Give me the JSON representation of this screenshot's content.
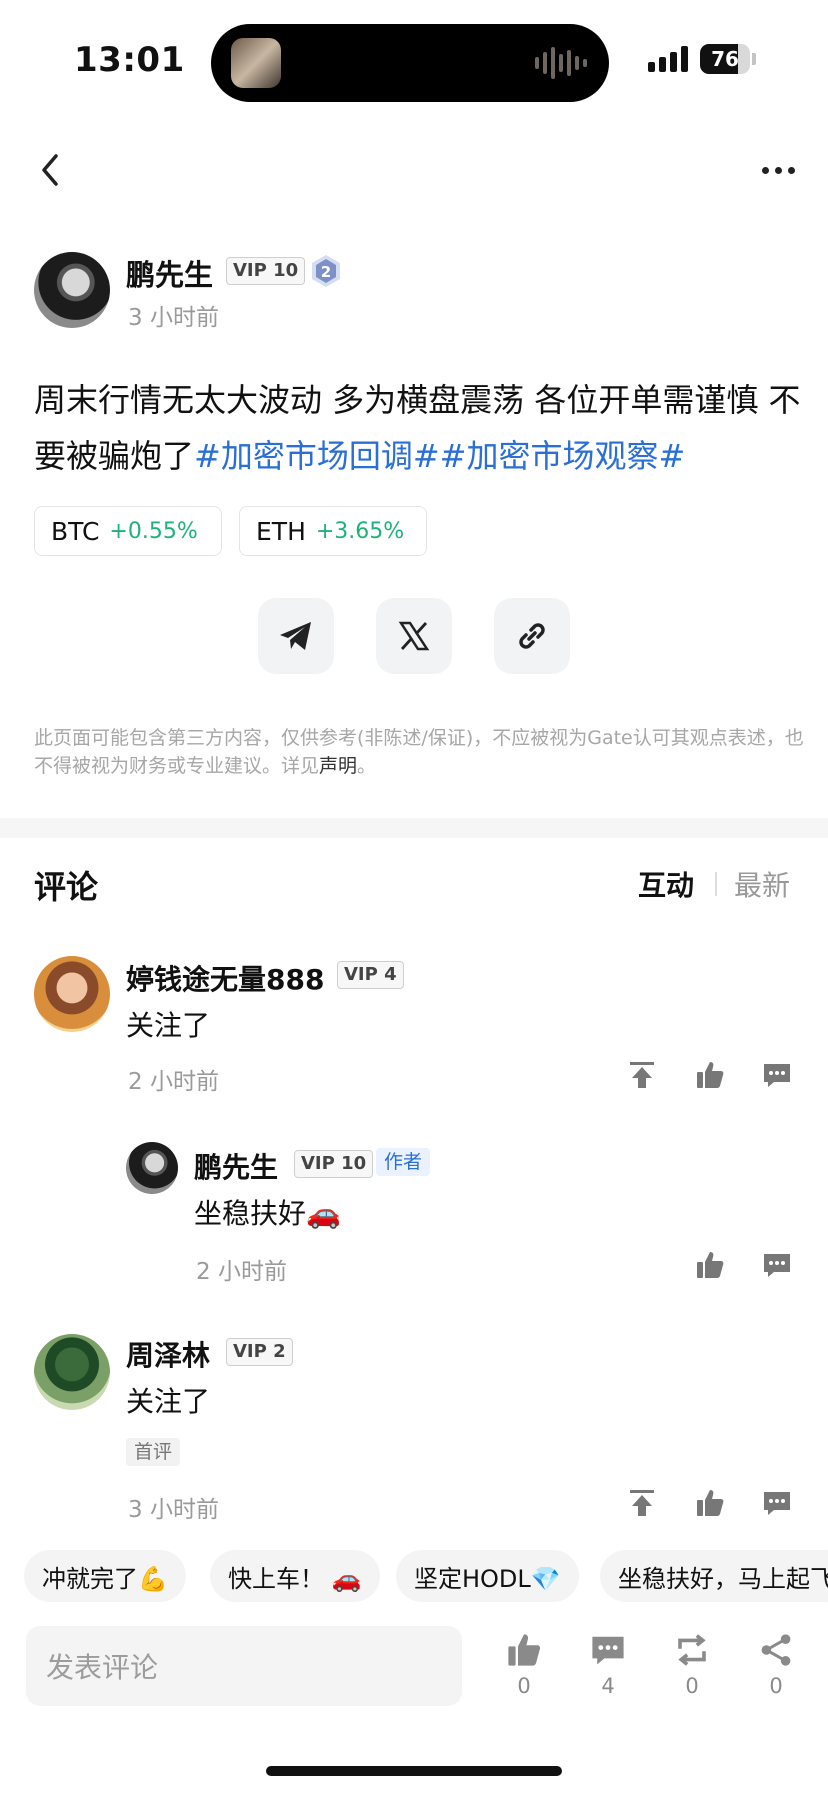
{
  "status_bar": {
    "time": "13:01",
    "battery": "76",
    "battery_level": 0.76
  },
  "post": {
    "author": "鹏先生",
    "vip": "VIP 10",
    "level_badge": "2",
    "time": "3 小时前",
    "text": "周末行情无太大波动  多为横盘震荡 各位开单需谨慎 不要被骗炮了",
    "hashtags": [
      "#加密市场回调#",
      "#加密市场观察#"
    ],
    "coins": [
      {
        "symbol": "BTC",
        "change": "+0.55%"
      },
      {
        "symbol": "ETH",
        "change": "+3.65%"
      }
    ],
    "share_icons": [
      "telegram-icon",
      "x-icon",
      "link-icon"
    ]
  },
  "disclaimer": {
    "text": "此页面可能包含第三方内容，仅供参考(非陈述/保证)，不应被视为Gate认可其观点表述，也不得被视为财务或专业建议。详见",
    "link": "声明",
    "end": "。"
  },
  "comments_section": {
    "title": "评论",
    "sort_hot": "互动",
    "sort_new": "最新"
  },
  "comments": [
    {
      "name": "婷钱途无量888",
      "vip": "VIP 4",
      "text": "关注了",
      "time": "2 小时前"
    },
    {
      "name": "鹏先生",
      "vip": "VIP 10",
      "tag": "作者",
      "text": "坐稳扶好🚗",
      "time": "2 小时前"
    },
    {
      "name": "周泽林",
      "vip": "VIP 2",
      "text": "关注了",
      "tag": "首评",
      "time": "3 小时前"
    }
  ],
  "quick_replies": [
    "冲就完了💪",
    "快上车！ 🚗",
    "坚定HODL💎",
    "坐稳扶好，马上起飞"
  ],
  "bottom_bar": {
    "placeholder": "发表评论",
    "likes": "0",
    "comments": "4",
    "reposts": "0",
    "shares": "0"
  },
  "colors": {
    "hashtag": "#2a6fd6",
    "positive": "#1db27a"
  }
}
